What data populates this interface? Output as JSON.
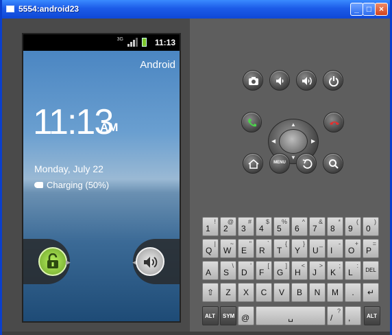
{
  "window": {
    "title": "5554:android23",
    "min_label": "_",
    "max_label": "□",
    "close_label": "×"
  },
  "status": {
    "network": "3G",
    "time": "11:13"
  },
  "lockscreen": {
    "carrier": "Android",
    "time": "11:13",
    "ampm": "AM",
    "date": "Monday, July 22",
    "charging": "Charging (50%)"
  },
  "controls": {
    "menu_label": "MENU"
  },
  "keyboard": {
    "row1": [
      {
        "main": "1",
        "alt": "!"
      },
      {
        "main": "2",
        "alt": "@"
      },
      {
        "main": "3",
        "alt": "#"
      },
      {
        "main": "4",
        "alt": "$"
      },
      {
        "main": "5",
        "alt": "%"
      },
      {
        "main": "6",
        "alt": "^"
      },
      {
        "main": "7",
        "alt": "&"
      },
      {
        "main": "8",
        "alt": "*"
      },
      {
        "main": "9",
        "alt": "("
      },
      {
        "main": "0",
        "alt": ")"
      }
    ],
    "row2": [
      {
        "main": "Q",
        "alt": "|"
      },
      {
        "main": "W",
        "alt": "~"
      },
      {
        "main": "E",
        "alt": "\""
      },
      {
        "main": "R",
        "alt": "`"
      },
      {
        "main": "T",
        "alt": "{"
      },
      {
        "main": "Y",
        "alt": "}"
      },
      {
        "main": "U",
        "alt": "_"
      },
      {
        "main": "I",
        "alt": "-"
      },
      {
        "main": "O",
        "alt": "+"
      },
      {
        "main": "P",
        "alt": "="
      }
    ],
    "row3": [
      {
        "main": "A",
        "alt": ""
      },
      {
        "main": "S",
        "alt": "\\"
      },
      {
        "main": "D",
        "alt": "'"
      },
      {
        "main": "F",
        "alt": "["
      },
      {
        "main": "G",
        "alt": "]"
      },
      {
        "main": "H",
        "alt": "<"
      },
      {
        "main": "J",
        "alt": ">"
      },
      {
        "main": "K",
        "alt": ";"
      },
      {
        "main": "L",
        "alt": ":"
      },
      {
        "main": "DEL",
        "alt": ""
      }
    ],
    "row4": [
      {
        "main": "⇧",
        "alt": ""
      },
      {
        "main": "Z",
        "alt": ""
      },
      {
        "main": "X",
        "alt": ""
      },
      {
        "main": "C",
        "alt": ""
      },
      {
        "main": "V",
        "alt": ""
      },
      {
        "main": "B",
        "alt": ""
      },
      {
        "main": "N",
        "alt": ""
      },
      {
        "main": "M",
        "alt": ""
      },
      {
        "main": ".",
        "alt": ""
      },
      {
        "main": "↵",
        "alt": ""
      }
    ],
    "row5": {
      "alt_left": "ALT",
      "sym": "SYM",
      "at": "@",
      "space": "␣",
      "slash": "/",
      "question": "?",
      "comma": ",",
      "alt_right": "ALT"
    }
  }
}
